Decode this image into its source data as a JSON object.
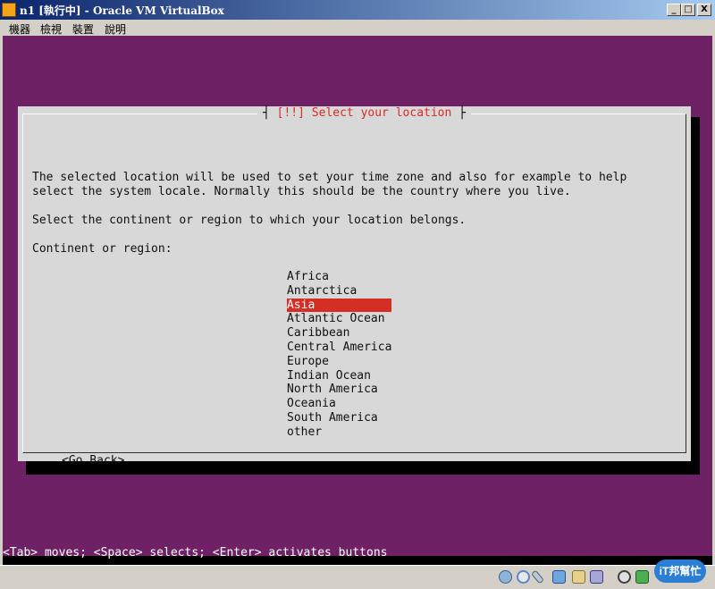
{
  "window": {
    "title": "n1 [執行中] - Oracle VM VirtualBox",
    "minimize": "_",
    "maximize": "□",
    "close": "X"
  },
  "menu": [
    "機器",
    "檢視",
    "裝置",
    "說明"
  ],
  "dialog": {
    "title": "[!!] Select your location",
    "intro_line1": "The selected location will be used to set your time zone and also for example to help",
    "intro_line2": "select the system locale. Normally this should be the country where you live.",
    "instruction": "Select the continent or region to which your location belongs.",
    "list_label": "Continent or region:",
    "options": [
      "Africa",
      "Antarctica",
      "Asia",
      "Atlantic Ocean",
      "Caribbean",
      "Central America",
      "Europe",
      "Indian Ocean",
      "North America",
      "Oceania",
      "South America",
      "other"
    ],
    "selected_option": "Asia",
    "go_back": "<Go Back>"
  },
  "status_hint": "<Tab> moves; <Space> selects; <Enter> activates buttons",
  "badge_text": "iT邦幫忙",
  "colors": {
    "vm_background": "#6f2166",
    "dialog_background": "#d8d8d8",
    "accent": "#d52e24"
  },
  "status_icons": [
    "hard-disk-icon",
    "cd-icon",
    "usb-pen-icon",
    "network-icon",
    "shared-folder-icon",
    "display-icon",
    "cpu-icon",
    "host-key-icon"
  ]
}
